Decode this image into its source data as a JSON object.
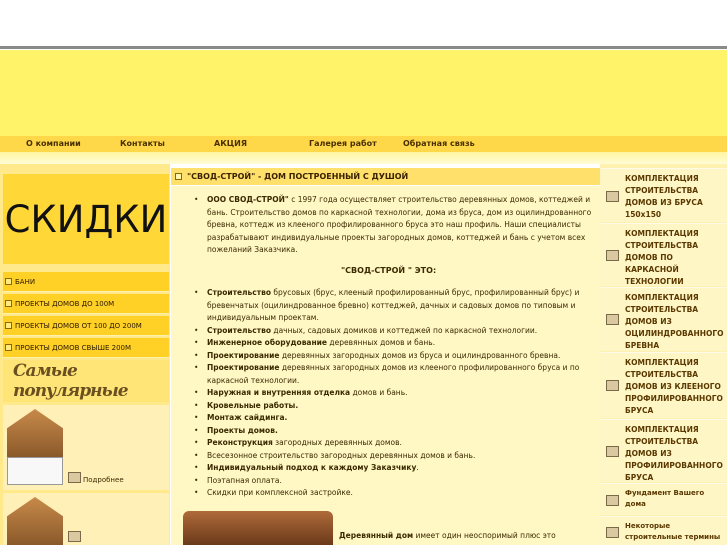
{
  "nav": {
    "items": [
      "О компании",
      "Контакты",
      "АКЦИЯ",
      "Галерея работ",
      "Обратная связь"
    ]
  },
  "left": {
    "promo": "СКИДКИ",
    "menu": [
      "БАНИ",
      "ПРОЕКТЫ ДОМОВ ДО 100М",
      "ПРОЕКТЫ ДОМОВ ОТ 100 ДО 200М",
      "ПРОЕКТЫ ДОМОВ СВЫШЕ 200М"
    ],
    "popular": "Самые популярные",
    "more": "Подробнее"
  },
  "main": {
    "heading": "\"СВОД-СТРОЙ\" - ДОМ ПОСТРОЕННЫЙ С ДУШОЙ",
    "intro_company": "ООО СВОД-СТРОЙ\"",
    "intro_rest": "с 1997 года осуществляет строительство деревянных домов, коттеджей и бань. Строительство домов по каркасной технологии, дома из бруса, дом из оцилиндрованного бревна, коттедж из клееного профилированного бруса это наш профиль. Наши специалисты разрабатывают индивидуальные проекты загородных домов, коттеджей и бань с учетом всех пожеланий Заказчика.",
    "subheading": "\"СВОД-СТРОЙ \" ЭТО:",
    "list": [
      {
        "b": "Строительство",
        "t": " брусовых (брус, клееный профилированный брус, профилированный брус) и бревенчатых (оцилиндрованное бревно) коттеджей, дачных и садовых домов по типовым и индивидуальным проектам."
      },
      {
        "b": "Строительство",
        "t": " дачных, садовых домиков и коттеджей по каркасной технологии."
      },
      {
        "b": "Инженерное оборудование",
        "t": " деревянных домов и бань."
      },
      {
        "b": "Проектирование",
        "t": " деревянных загородных домов из бруса и оцилиндрованного бревна."
      },
      {
        "b": "Проектирование",
        "t": " деревянных загородных домов из клееного профилированного бруса и по каркасной технологии."
      },
      {
        "b": "Наружная и внутренняя отделка",
        "t": " домов и бань."
      },
      {
        "b": "Кровельные работы.",
        "t": ""
      },
      {
        "b": "Монтаж сайдинга.",
        "t": ""
      },
      {
        "b": "Проекты домов.",
        "t": ""
      },
      {
        "b": "Реконструкция",
        "t": " загородных деревянных домов."
      },
      {
        "b": "",
        "t": "Всесезонное строительство загородных деревянных домов и бань."
      },
      {
        "b": "Индивидуальный подход к каждому Заказчику",
        "t": "."
      },
      {
        "b": "",
        "t": "Поэтапная оплата."
      },
      {
        "b": "",
        "t": "Скидки при комплексной застройке."
      }
    ],
    "bottom_bold": "Деревянный дом",
    "bottom_rest": " имеет один неоспоримый плюс это"
  },
  "right": {
    "items": [
      "КОМПЛЕКТАЦИЯ СТРОИТЕЛЬСТВА ДОМОВ ИЗ БРУСА 150х150",
      "КОМПЛЕКТАЦИЯ СТРОИТЕЛЬСТВА ДОМОВ ПО КАРКАСНОЙ ТЕХНОЛОГИИ",
      "КОМПЛЕКТАЦИЯ СТРОИТЕЛЬСТВА ДОМОВ ИЗ ОЦИЛИНДРОВАННОГО БРЕВНА",
      "КОМПЛЕКТАЦИЯ СТРОИТЕЛЬСТВА ДОМОВ ИЗ КЛЕЕНОГО ПРОФИЛИРОВАННОГО БРУСА",
      "КОМПЛЕКТАЦИЯ СТРОИТЕЛЬСТВА ДОМОВ ИЗ ПРОФИЛИРОВАННОГО БРУСА",
      "Фундамент Вашего дома",
      "Некоторые строительные термины"
    ]
  }
}
